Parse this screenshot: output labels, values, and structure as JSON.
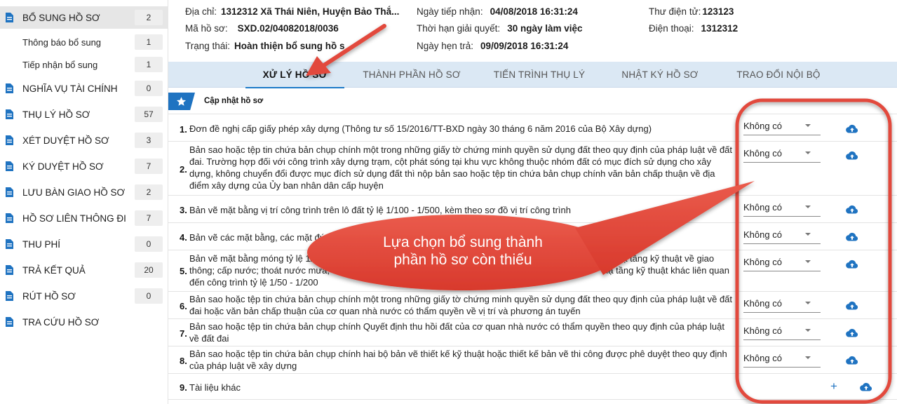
{
  "sidebar": {
    "items": [
      {
        "label": "BỔ SUNG HỒ SƠ",
        "count": "2"
      },
      {
        "label": "Thông báo bổ sung",
        "count": "1"
      },
      {
        "label": "Tiếp nhận bổ sung",
        "count": "1"
      },
      {
        "label": "NGHĨA VỤ TÀI CHÍNH",
        "count": "0"
      },
      {
        "label": "THỤ LÝ HỒ SƠ",
        "count": "57"
      },
      {
        "label": "XÉT DUYỆT HỒ SƠ",
        "count": "3"
      },
      {
        "label": "KÝ DUYỆT HỒ SƠ",
        "count": "7"
      },
      {
        "label": "LƯU BÀN GIAO HỒ SƠ",
        "count": "2"
      },
      {
        "label": "HỒ SƠ LIÊN THÔNG ĐI",
        "count": "7"
      },
      {
        "label": "THU PHÍ",
        "count": "0"
      },
      {
        "label": "TRẢ KẾT QUẢ",
        "count": "20"
      },
      {
        "label": "RÚT HỒ SƠ",
        "count": "0"
      },
      {
        "label": "TRA CỨU HỒ SƠ",
        "count": ""
      }
    ]
  },
  "info": {
    "address_label": "Địa chỉ:",
    "address_value": "1312312 Xã Thái Niên, Huyện Bảo Thắ...",
    "code_label": "Mã hồ sơ:",
    "code_value": "SXD.02/04082018/0036",
    "status_label": "Trạng thái:",
    "status_value": "Hoàn thiện bổ sung hồ s",
    "received_label": "Ngày tiếp nhận:",
    "received_value": "04/08/2018 16:31:24",
    "deadline_label": "Thời hạn giải quyết:",
    "deadline_value": "30 ngày làm việc",
    "appointment_label": "Ngày hẹn trả:",
    "appointment_value": "09/09/2018 16:31:24",
    "email_label": "Thư điện tử:",
    "email_value": "123123",
    "phone_label": "Điện thoại:",
    "phone_value": "1312312"
  },
  "tabs": [
    {
      "label": "XỬ LÝ HỒ SƠ"
    },
    {
      "label": "THÀNH PHẦN HỒ SƠ"
    },
    {
      "label": "TIẾN TRÌNH THỤ LÝ"
    },
    {
      "label": "NHẬT KÝ HỒ SƠ"
    },
    {
      "label": "TRAO ĐỔI NỘI BỘ"
    }
  ],
  "section": {
    "title": "Cập nhật hồ sơ"
  },
  "documents": [
    {
      "num": "1.",
      "text": "Đơn đề nghị cấp giấy phép xây dựng (Thông tư số 15/2016/TT-BXD ngày 30 tháng 6 năm 2016 của Bộ Xây dựng)",
      "option": "Không có"
    },
    {
      "num": "2.",
      "text": "Bản sao hoặc tệp tin chứa bản chụp chính một trong những giấy tờ chứng minh quyền sử dụng đất theo quy định của pháp luật về đất đai. Trường hợp đối với công trình xây dựng trạm, cột phát sóng tại khu vực không thuộc nhóm đất có mục đích sử dụng cho xây dựng, không chuyển đổi được mục đích sử dụng đất thì nộp bản sao hoặc tệp tin chứa bản chụp chính văn bản chấp thuận về địa điểm xây dựng của Ủy ban nhân dân cấp huyện",
      "option": "Không có"
    },
    {
      "num": "3.",
      "text": "Bản vẽ mặt bằng vị trí công trình trên lô đất tỷ lệ 1/100 - 1/500, kèm theo sơ đồ vị trí công trình",
      "option": "Không có"
    },
    {
      "num": "4.",
      "text": "Bản vẽ các mặt bằng, các mặt đứ",
      "option": "Không có"
    },
    {
      "num": "5.",
      "text": "Bản vẽ mặt bằng móng tỷ lệ 1/1",
      "text_right": "hạ tầng kỹ thuật về giao",
      "text2": "thông; cấp nước; thoát nước mưa,",
      "text2_right": "hạ tầng kỹ thuật khác liên quan",
      "text3": "đến công trình tỷ lệ 1/50 - 1/200",
      "option": "Không có"
    },
    {
      "num": "6.",
      "text": "Bản sao hoặc tệp tin chứa bản chụp chính một trong những giấy tờ chứng minh quyền sử dụng đất theo quy định của pháp luật về đất đai hoặc văn bản chấp thuận của cơ quan nhà nước có thẩm quyền về vị trí và phương án tuyến",
      "option": "Không có"
    },
    {
      "num": "7.",
      "text": "Bản sao hoặc tệp tin chứa bản chụp chính Quyết định thu hồi đất của cơ quan nhà nước có thẩm quyền theo quy định của pháp luật về đất đai",
      "option": "Không có"
    },
    {
      "num": "8.",
      "text": "Bản sao hoặc tệp tin chứa bản chụp chính hai bộ bản vẽ thiết kế kỹ thuật hoặc thiết kế bản vẽ thi công được phê duyệt theo quy định của pháp luật về xây dựng",
      "option": "Không có"
    },
    {
      "num": "9.",
      "text": "Tài liệu khác"
    }
  ],
  "annotation": {
    "callout_line1": "Lựa chọn bổ sung thành",
    "callout_line2": "phần hồ sơ còn thiếu",
    "accent_color": "#e24a3c"
  },
  "icons": {
    "sidebar": "document-icon",
    "upload": "cloud-upload-icon",
    "add": "plus-icon",
    "section": "star-icon"
  }
}
